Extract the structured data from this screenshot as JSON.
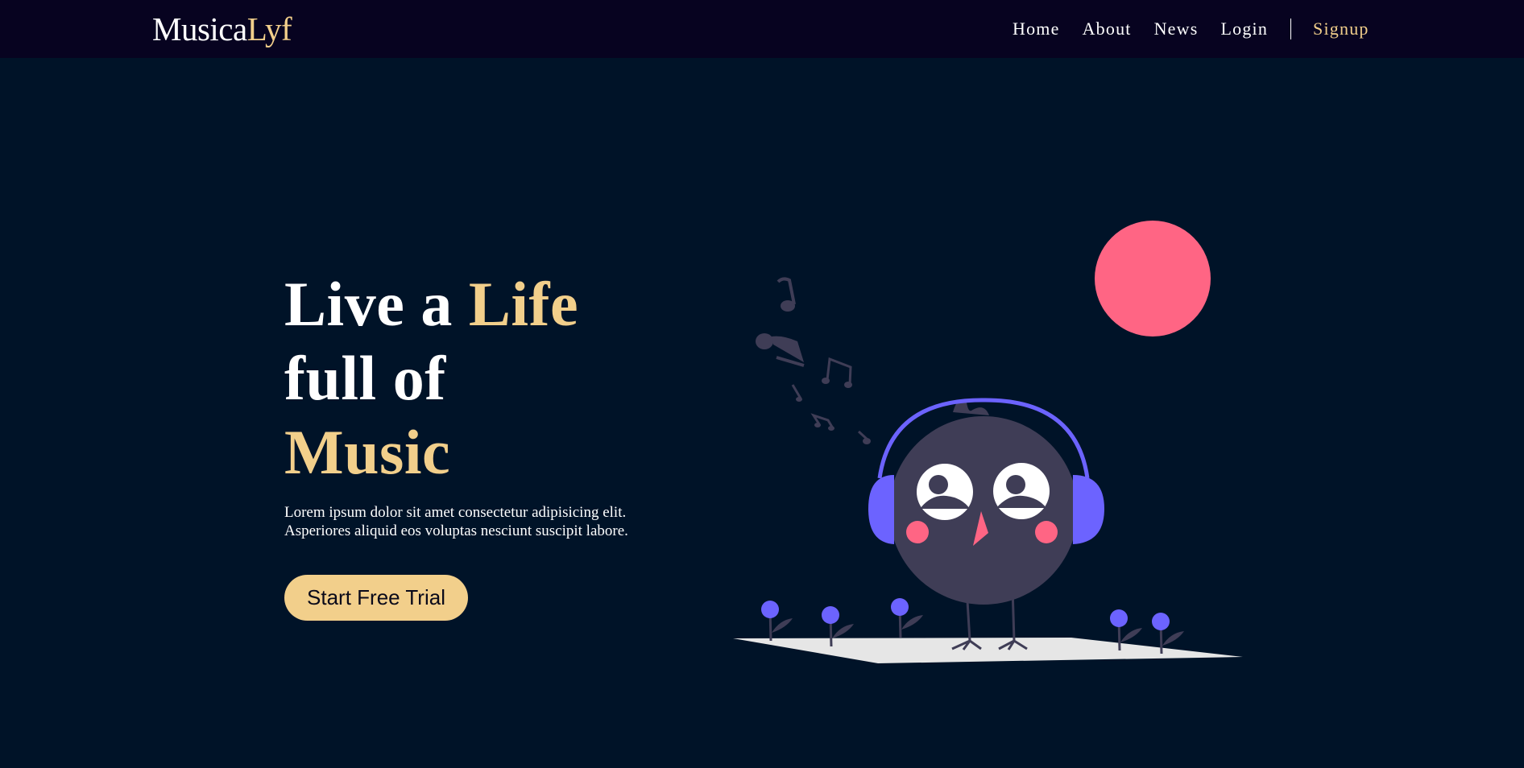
{
  "brand": {
    "part1": "Musica",
    "part2": "Lyf"
  },
  "nav": {
    "home": "Home",
    "about": "About",
    "news": "News",
    "login": "Login",
    "signup": "Signup"
  },
  "hero": {
    "line1_a": "Live a ",
    "line1_b": "Life",
    "line2": "full of",
    "line3": "Music",
    "description": "Lorem ipsum dolor sit amet consectetur adipisicing elit. Asperiores aliquid eos voluptas nesciunt suscipit labore.",
    "cta_label": "Start Free Trial"
  },
  "colors": {
    "background": "#001328",
    "navbar": "#070320",
    "accent": "#f2cf8b",
    "sun": "#ff6584",
    "headphones": "#6c63ff",
    "bird": "#3f3d56",
    "ground": "#e6e6e6"
  },
  "illustration": {
    "icon": "bird-with-headphones-illustration",
    "notes_icon": "music-notes-icon",
    "sun_icon": "sun-icon"
  }
}
